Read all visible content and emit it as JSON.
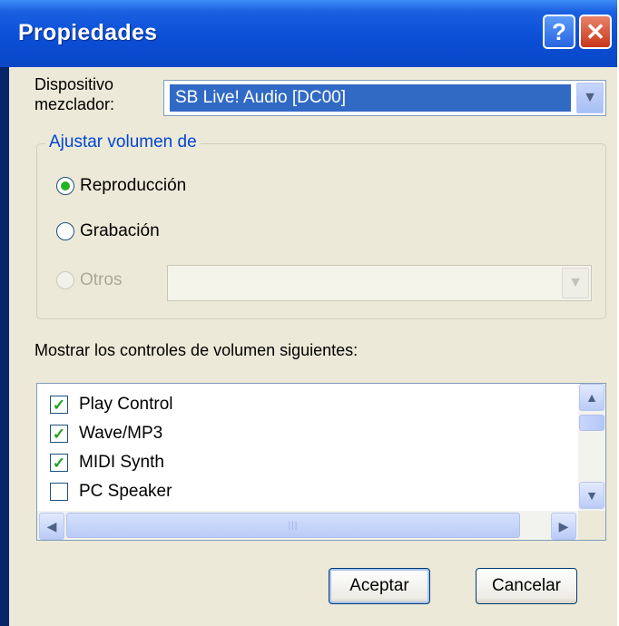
{
  "window": {
    "title": "Propiedades",
    "help_glyph": "?",
    "close_glyph": "✕"
  },
  "device": {
    "label_line1": "Dispositivo",
    "label_line2": "mezclador:",
    "selected": "SB Live! Audio [DC00]"
  },
  "volume_group": {
    "legend": "Ajustar volumen de",
    "options": [
      {
        "label": "Reproducción",
        "checked": true,
        "enabled": true
      },
      {
        "label": "Grabación",
        "checked": false,
        "enabled": true
      },
      {
        "label": "Otros",
        "checked": false,
        "enabled": false
      }
    ],
    "otros_combo_value": ""
  },
  "controls": {
    "label": "Mostrar los controles de volumen siguientes:",
    "items": [
      {
        "label": "Play Control",
        "checked": true
      },
      {
        "label": "Wave/MP3",
        "checked": true
      },
      {
        "label": "MIDI Synth",
        "checked": true
      },
      {
        "label": "PC Speaker",
        "checked": false
      }
    ]
  },
  "buttons": {
    "ok": "Aceptar",
    "cancel": "Cancelar"
  },
  "icons": {
    "help": "question-icon",
    "close": "close-icon",
    "dropdown": "chevron-down-icon"
  },
  "colors": {
    "titlebar": "#0b4fd6",
    "selection": "#316ac5",
    "group_legend": "#0046d5",
    "dialog_bg": "#ece9d8"
  }
}
